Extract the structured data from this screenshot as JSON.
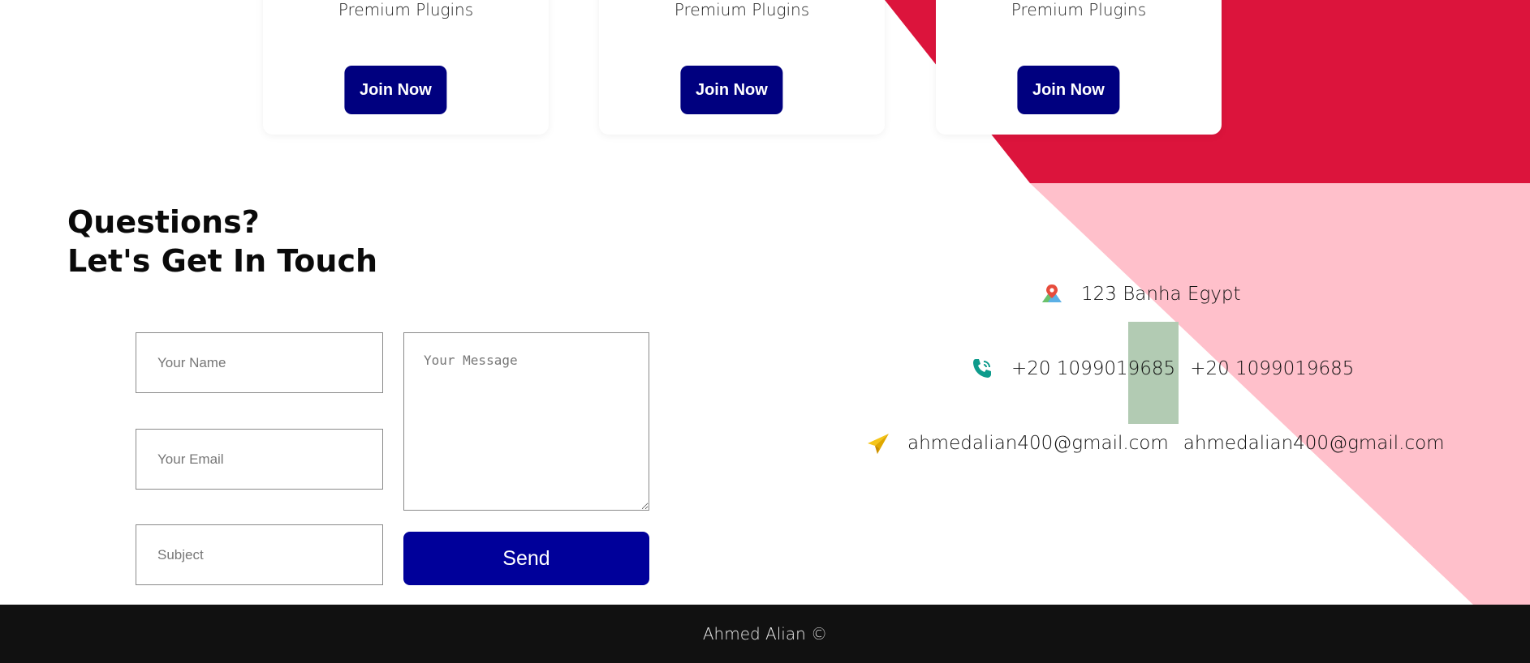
{
  "pricing": {
    "cards": [
      {
        "feature": "Premium Plugins",
        "button": "Join Now"
      },
      {
        "feature": "Premium Plugins",
        "button": "Join Now"
      },
      {
        "feature": "Premium Plugins",
        "button": "Join Now"
      }
    ]
  },
  "contact": {
    "heading_line1": "Questions?",
    "heading_line2": "Let's Get In Touch",
    "form": {
      "name_placeholder": "Your Name",
      "email_placeholder": "Your Email",
      "subject_placeholder": "Subject",
      "message_placeholder": "Your Message",
      "send_label": "Send"
    },
    "info": {
      "address": "123 Banha Egypt",
      "phone_1": "+20 1099019685",
      "phone_2": "+20 1099019685",
      "email_1": "ahmedalian400@gmail.com",
      "email_2": "ahmedalian400@gmail.com",
      "icons": [
        "map-pin-icon",
        "phone-icon",
        "paper-plane-icon"
      ]
    }
  },
  "footer": {
    "text": "Ahmed Alian ©"
  },
  "colors": {
    "crimson": "#dc143c",
    "pink": "#ffc0cb",
    "navy_button": "#00007f",
    "footer_bg": "#111111"
  }
}
